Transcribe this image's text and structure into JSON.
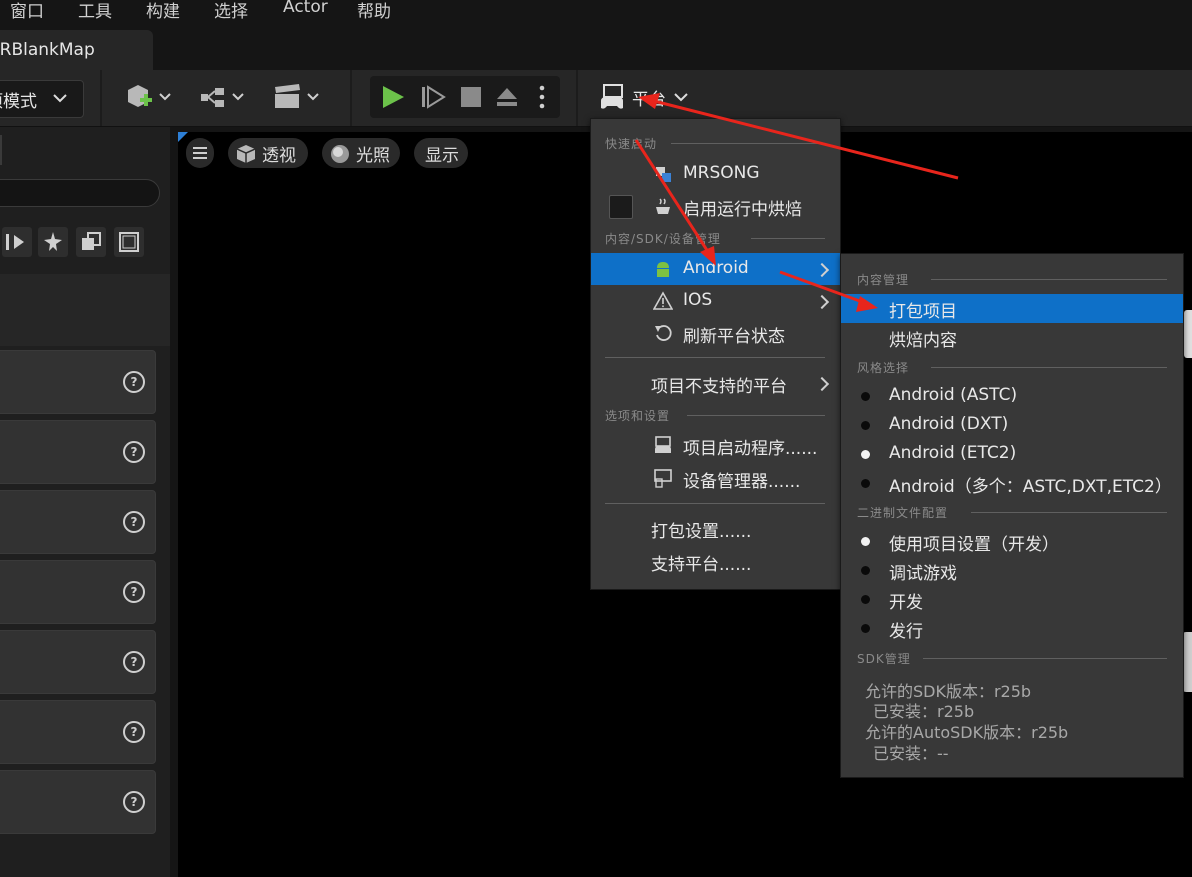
{
  "menubar": {
    "items": [
      "窗口",
      "工具",
      "构建",
      "选择",
      "Actor",
      "帮助"
    ]
  },
  "tab": {
    "title": "ARBlankMap"
  },
  "toolbar": {
    "mode_label": "选项模式",
    "platform_label": "平台"
  },
  "viewport": {
    "perspective_label": "透视",
    "lighting_label": "光照",
    "show_label": "显示"
  },
  "platform_menu": {
    "section_quick_launch": "快速启动",
    "device_name": "MRSONG",
    "cook_on_fly_label": "启用运行中烘焙",
    "section_content_sdk": "内容/SDK/设备管理",
    "android_label": "Android",
    "ios_label": "IOS",
    "refresh_label": "刷新平台状态",
    "unsupported_label": "项目不支持的平台",
    "section_options": "选项和设置",
    "launcher_label": "项目启动程序......",
    "device_manager_label": "设备管理器......",
    "package_settings_label": "打包设置......",
    "supported_platforms_label": "支持平台......"
  },
  "android_submenu": {
    "section_content": "内容管理",
    "package_project": "打包项目",
    "cook_content": "烘焙内容",
    "section_flavor": "风格选择",
    "flavors": [
      {
        "label": "Android (ASTC)",
        "selected": false
      },
      {
        "label": "Android (DXT)",
        "selected": false
      },
      {
        "label": "Android (ETC2)",
        "selected": true
      },
      {
        "label": "Android（多个：ASTC,DXT,ETC2）",
        "selected": false
      }
    ],
    "section_binary": "二进制文件配置",
    "binary_configs": [
      {
        "label": "使用项目设置（开发）",
        "selected": true
      },
      {
        "label": "调试游戏",
        "selected": false
      },
      {
        "label": "开发",
        "selected": false
      },
      {
        "label": "发行",
        "selected": false
      }
    ],
    "section_sdk": "SDK管理",
    "sdk_lines": [
      "允许的SDK版本：r25b",
      "已安装：r25b",
      "允许的AutoSDK版本：r25b",
      "已安装：--"
    ]
  },
  "colors": {
    "highlight": "#0e70c8",
    "play_green": "#6cc24a",
    "annotation_red": "#e8251c",
    "android_green": "#7cc142"
  }
}
